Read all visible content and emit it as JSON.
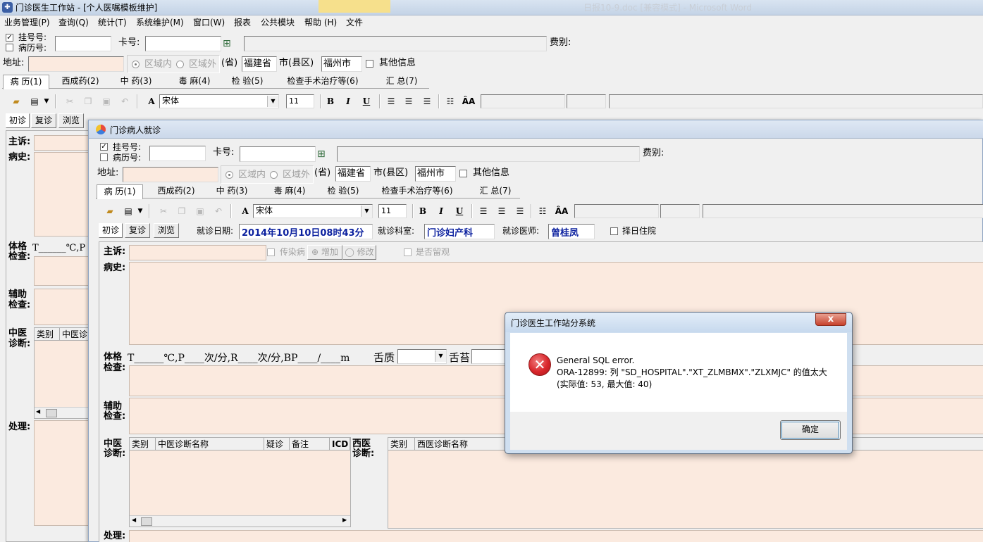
{
  "taskbar": {
    "hint_text": "日报10-9.doc [兼容模式] - Microsoft Word"
  },
  "main_window": {
    "title": "门诊医生工作站 - [个人医嘱模板维护]",
    "menu": [
      "业务管理(P)",
      "查询(Q)",
      "统计(T)",
      "系统维护(M)",
      "窗口(W)",
      "报表",
      "公共模块",
      "帮助 (H)",
      "文件"
    ],
    "reg_no_label": "挂号号:",
    "record_no_label": "病历号:",
    "card_label": "卡号:",
    "fee_label": "费别:",
    "address_label": "地址:",
    "region_inside": "区域内",
    "region_outside": "区域外",
    "province_label": "(省)",
    "province_value": "福建省",
    "city_label": "市(县区)",
    "city_value": "福州市",
    "other_info": "其他信息",
    "tabs": [
      "病 历(1)",
      "西成药(2)",
      "中 药(3)",
      "毒 麻(4)",
      "检 验(5)",
      "检查手术治疗等(6)",
      "汇 总(7)"
    ],
    "font_name": "宋体",
    "font_size": "11",
    "subtabs": [
      "初诊",
      "复诊",
      "浏览"
    ],
    "labels": {
      "complaint": "主诉:",
      "history": "病史:",
      "body_exam": [
        "体格",
        "检查:"
      ],
      "vitals": "T______℃,P",
      "aux_exam": [
        "辅助",
        "检查:"
      ],
      "tcm_diag": [
        "中医",
        "诊断:"
      ],
      "treatment": "处理:"
    },
    "grid_headers": [
      "类别",
      "中医诊"
    ]
  },
  "child_window": {
    "title": "门诊病人就诊",
    "reg_no_label": "挂号号:",
    "record_no_label": "病历号:",
    "card_label": "卡号:",
    "fee_label": "费别:",
    "address_label": "地址:",
    "region_inside": "区域内",
    "region_outside": "区域外",
    "province_label": "(省)",
    "province_value": "福建省",
    "city_label": "市(县区)",
    "city_value": "福州市",
    "other_info": "其他信息",
    "tabs": [
      "病 历(1)",
      "西成药(2)",
      "中 药(3)",
      "毒 麻(4)",
      "检 验(5)",
      "检查手术治疗等(6)",
      "汇 总(7)"
    ],
    "font_name": "宋体",
    "font_size": "11",
    "subtabs": [
      "初诊",
      "复诊",
      "浏览"
    ],
    "visit_date_label": "就诊日期:",
    "visit_date_value": "2014年10月10日08时43分",
    "dept_label": "就诊科室:",
    "dept_value": "门诊妇产科",
    "doctor_label": "就诊医师:",
    "doctor_value": "曾桂凤",
    "admit_label": "择日住院",
    "labels": {
      "complaint": "主诉:",
      "history": "病史:",
      "body_exam": [
        "体格",
        "检查:"
      ],
      "aux_exam": [
        "辅助",
        "检查:"
      ],
      "tcm_diag": [
        "中医",
        "诊断:"
      ],
      "west_diag": [
        "西医",
        "诊断:"
      ],
      "treatment": "处理:"
    },
    "infectious_label": "传染病",
    "add_label": "增加",
    "edit_label": "修改",
    "observe_label": "是否留观",
    "vitals": "T______℃,P____次/分,R____次/分,BP____/____m",
    "tongue_quality_label": "舌质",
    "tongue_coating_label": "舌苔",
    "tcm_grid_headers": [
      "类别",
      "中医诊断名称",
      "疑诊",
      "备注",
      "ICD"
    ],
    "west_grid_headers": [
      "类别",
      "西医诊断名称"
    ]
  },
  "dialog": {
    "title": "门诊医生工作站分系统",
    "close_label": "x",
    "message_line1": "General SQL error.",
    "message_line2": "ORA-12899: 列 \"SD_HOSPITAL\".\"XT_ZLMBMX\".\"ZLXMJC\" 的值太大",
    "message_line3": "(实际值: 53, 最大值: 40)",
    "ok_label": "确定"
  },
  "colors": {
    "peach": "#fbeadf",
    "date_blue": "#0a1f9e",
    "error_red": "#d9262b"
  },
  "icons": [
    "app-icon",
    "read-card-icon",
    "open-folder-icon",
    "print-icon",
    "cut-icon",
    "copy-icon",
    "paste-icon",
    "undo-icon",
    "font-icon",
    "bold-icon",
    "italic-icon",
    "underline-icon",
    "align-left-icon",
    "align-center-icon",
    "align-right-icon",
    "bullet-list-icon",
    "font-size-icon",
    "error-icon",
    "close-icon"
  ]
}
